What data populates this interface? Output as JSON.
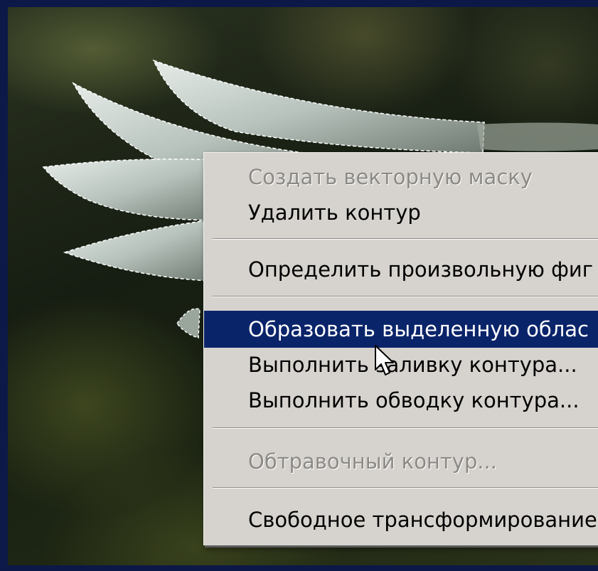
{
  "context_menu": {
    "items": [
      {
        "label": "Создать векторную маску",
        "enabled": false
      },
      {
        "label": "Удалить контур",
        "enabled": true
      },
      {
        "label": "Определить произвольную фиг",
        "enabled": true
      },
      {
        "label": "Образовать выделенную облас",
        "enabled": true,
        "highlighted": true
      },
      {
        "label": "Выполнить заливку контура...",
        "enabled": true
      },
      {
        "label": "Выполнить обводку контура...",
        "enabled": true
      },
      {
        "label": "Обтравочный контур...",
        "enabled": false
      },
      {
        "label": "Свободное трансформирование",
        "enabled": true
      }
    ]
  },
  "colors": {
    "frame": "#0c1847",
    "menu_bg": "#d6d3ce",
    "highlight": "#0a246a",
    "disabled_text": "#8c8a86"
  },
  "icons": [
    "mouse-pointer-icon"
  ]
}
